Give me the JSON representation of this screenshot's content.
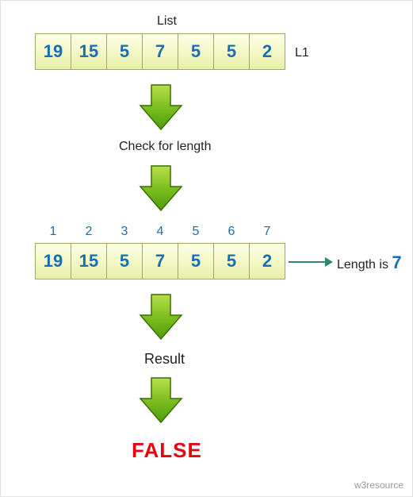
{
  "title": "List",
  "list_name": "L1",
  "list_values": [
    "19",
    "15",
    "5",
    "7",
    "5",
    "5",
    "2"
  ],
  "step_check_label": "Check for length",
  "indices": [
    "1",
    "2",
    "3",
    "4",
    "5",
    "6",
    "7"
  ],
  "length_prefix": "Length is ",
  "length_value": "7",
  "result_label": "Result",
  "result_value": "FALSE",
  "credit": "w3resource"
}
